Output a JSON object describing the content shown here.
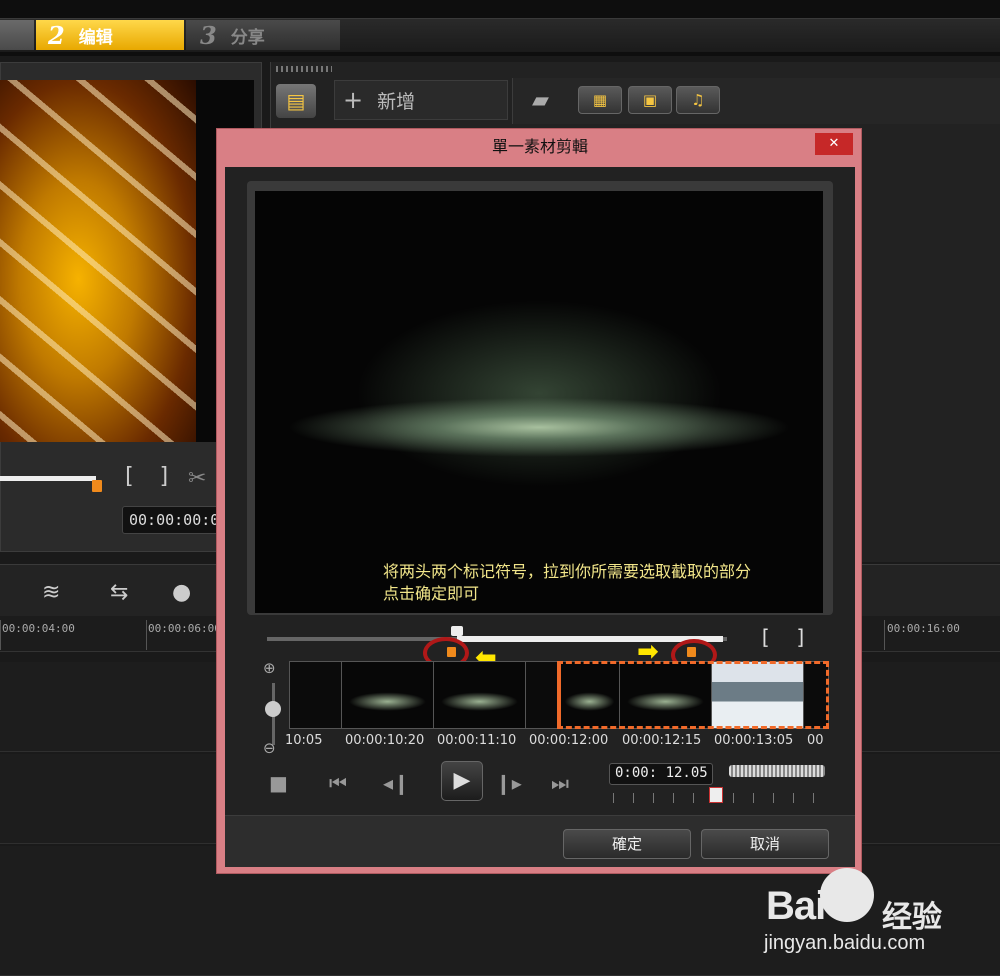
{
  "app": {
    "tabs": [
      {
        "num": "2",
        "label": "编辑"
      },
      {
        "num": "3",
        "label": "分享"
      }
    ]
  },
  "preview": {
    "timecode": "00:00:00:0",
    "mark_in": "[",
    "mark_out": "]",
    "slider_fraction": 0.37
  },
  "library": {
    "add_label": "新增"
  },
  "timeline": {
    "ruler": [
      "00:00:04:00",
      "00:00:06:00",
      "00:00:16:00"
    ]
  },
  "dialog": {
    "title": "單一素材剪輯",
    "close": "✕",
    "annotation_line1": "将两头两个标记符号，拉到你所需要选取截取的部分",
    "annotation_line2": "点击确定即可",
    "mark_in": "[",
    "mark_out": "]",
    "filmstrip_times": [
      "10:05",
      "00:00:10:20",
      "00:00:11:10",
      "00:00:12:00",
      "00:00:12:15",
      "00:00:13:05",
      "00"
    ],
    "timecode": "0:00: 12.05",
    "confirm": "確定",
    "cancel": "取消"
  },
  "watermark": {
    "brand": "Bai",
    "brand_suffix": "经验",
    "url": "jingyan.baidu.com"
  },
  "colors": {
    "accent": "#f5b800",
    "dialog_border": "#d97f85",
    "trim_marker": "#f08a1c",
    "selection": "#f06a2a",
    "annotation": "#f2e68a"
  }
}
